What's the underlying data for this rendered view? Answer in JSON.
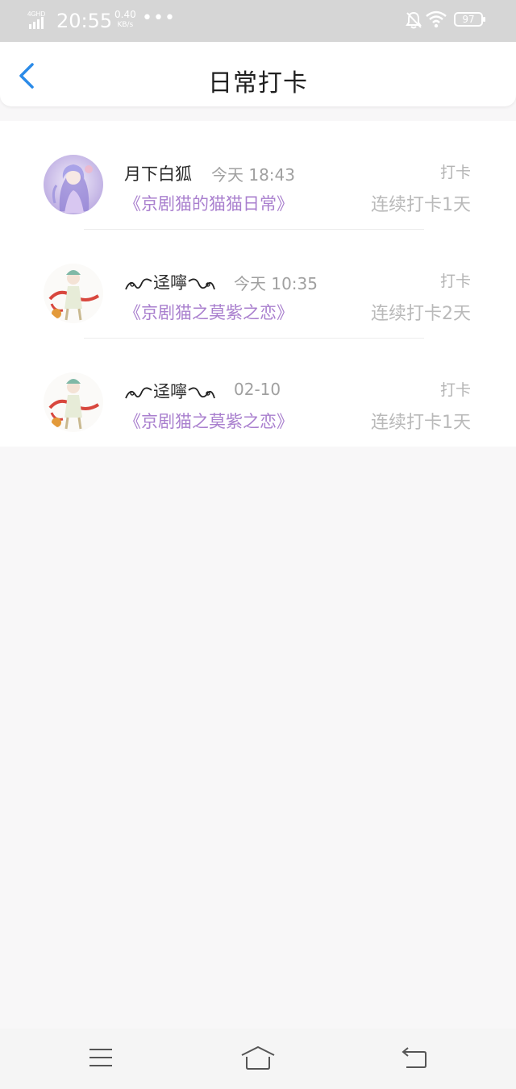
{
  "status_bar": {
    "network": "4GHD",
    "time": "20:55",
    "speed_value": "0.40",
    "speed_unit": "KB/s",
    "dots": "•••",
    "battery": "97",
    "icons": [
      "signal-icon",
      "bell-off-icon",
      "wifi-icon",
      "battery-icon"
    ]
  },
  "header": {
    "title": "日常打卡",
    "back_icon": "chevron-left-icon",
    "accent_color": "#2b8be8"
  },
  "checkins": [
    {
      "name": "月下白狐",
      "time": "今天 18:43",
      "book": "《京剧猫的猫猫日常》",
      "tag": "打卡",
      "streak": "连续打卡1天"
    },
    {
      "name": "迳嚀",
      "time": "今天 10:35",
      "book": "《京剧猫之莫紫之恋》",
      "tag": "打卡",
      "streak": "连续打卡2天"
    },
    {
      "name": "迳嚀",
      "time": "02-10",
      "book": "《京剧猫之莫紫之恋》",
      "tag": "打卡",
      "streak": "连续打卡1天"
    }
  ],
  "colors": {
    "book_title": "#a97fce",
    "streak": "#b9b9b9",
    "background": "#f8f7f8"
  },
  "navbar": {
    "icons": [
      "menu-icon",
      "home-icon",
      "back-icon"
    ]
  }
}
